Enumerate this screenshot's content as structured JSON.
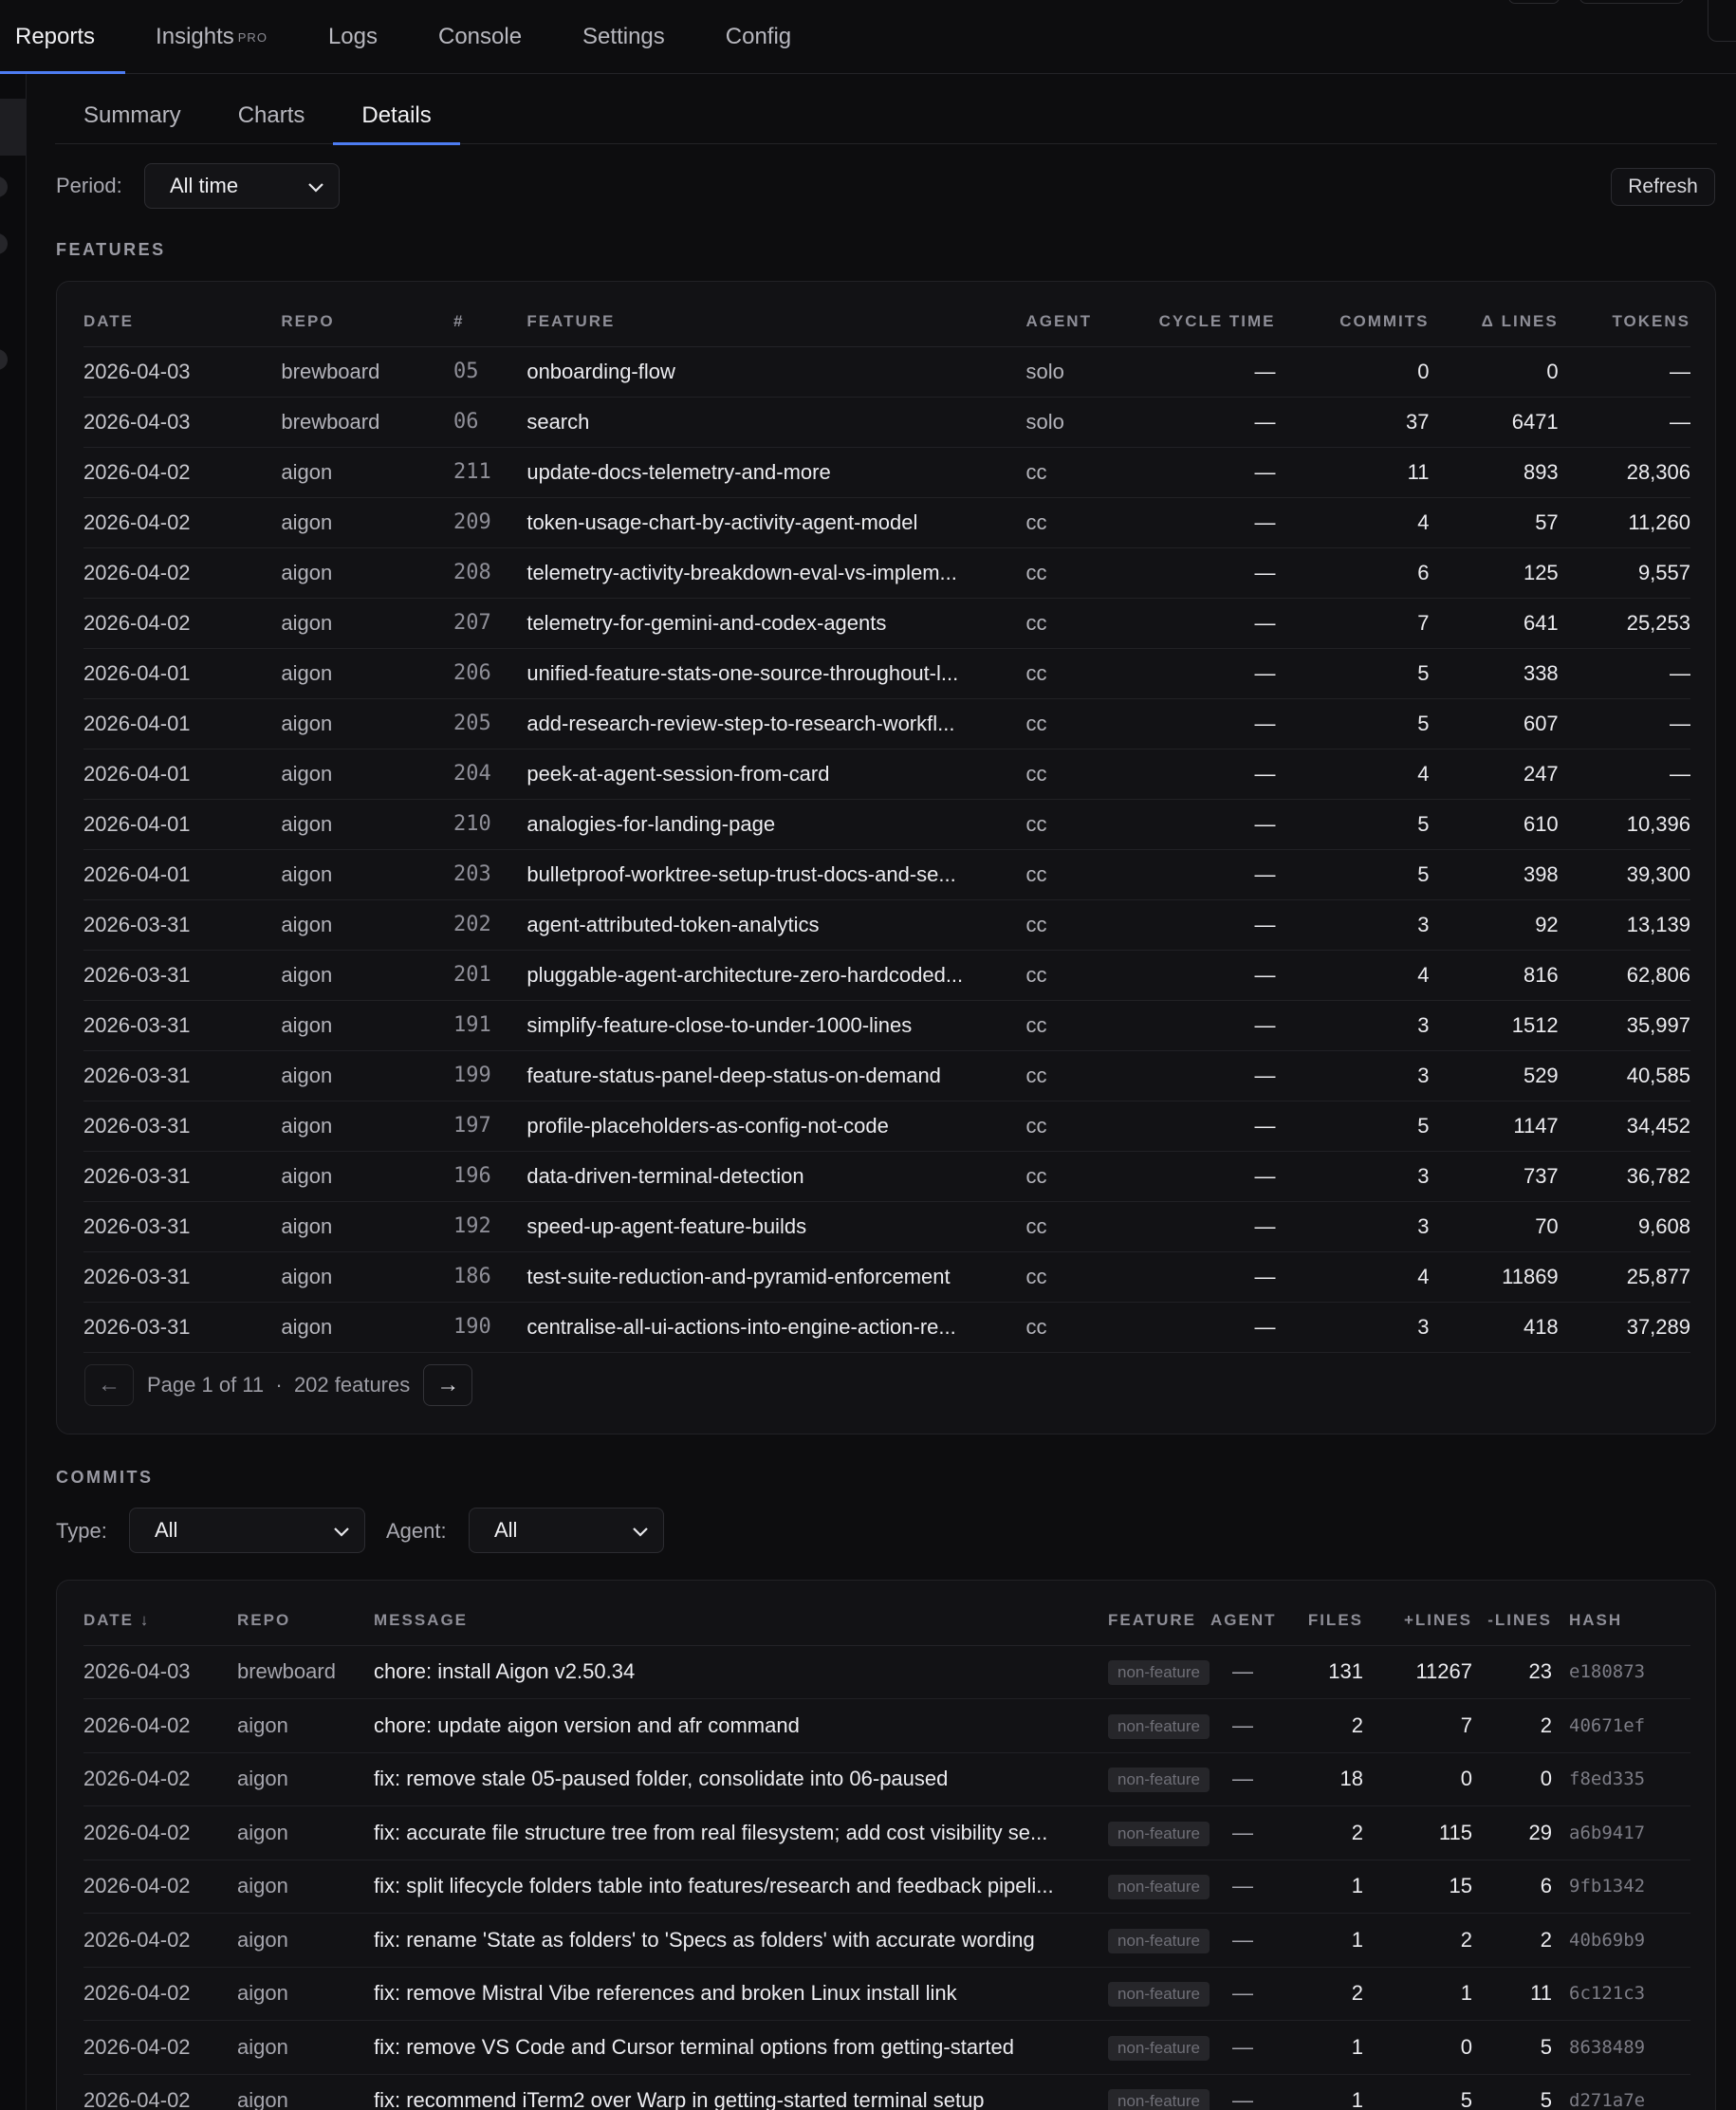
{
  "nav": {
    "tabs": [
      "Reports",
      "Insights",
      "Logs",
      "Console",
      "Settings",
      "Config"
    ],
    "pro_badge": "PRO"
  },
  "subtabs": [
    "Summary",
    "Charts",
    "Details"
  ],
  "period": {
    "label": "Period:",
    "value": "All time"
  },
  "refresh_label": "Refresh",
  "features": {
    "title": "FEATURES",
    "columns": [
      "DATE",
      "REPO",
      "#",
      "FEATURE",
      "AGENT",
      "CYCLE TIME",
      "COMMITS",
      "Δ LINES",
      "TOKENS"
    ],
    "rows": [
      [
        "2026-04-03",
        "brewboard",
        "05",
        "onboarding-flow",
        "solo",
        "—",
        "0",
        "0",
        "—"
      ],
      [
        "2026-04-03",
        "brewboard",
        "06",
        "search",
        "solo",
        "—",
        "37",
        "6471",
        "—"
      ],
      [
        "2026-04-02",
        "aigon",
        "211",
        "update-docs-telemetry-and-more",
        "cc",
        "—",
        "11",
        "893",
        "28,306"
      ],
      [
        "2026-04-02",
        "aigon",
        "209",
        "token-usage-chart-by-activity-agent-model",
        "cc",
        "—",
        "4",
        "57",
        "11,260"
      ],
      [
        "2026-04-02",
        "aigon",
        "208",
        "telemetry-activity-breakdown-eval-vs-implem...",
        "cc",
        "—",
        "6",
        "125",
        "9,557"
      ],
      [
        "2026-04-02",
        "aigon",
        "207",
        "telemetry-for-gemini-and-codex-agents",
        "cc",
        "—",
        "7",
        "641",
        "25,253"
      ],
      [
        "2026-04-01",
        "aigon",
        "206",
        "unified-feature-stats-one-source-throughout-l...",
        "cc",
        "—",
        "5",
        "338",
        "—"
      ],
      [
        "2026-04-01",
        "aigon",
        "205",
        "add-research-review-step-to-research-workfl...",
        "cc",
        "—",
        "5",
        "607",
        "—"
      ],
      [
        "2026-04-01",
        "aigon",
        "204",
        "peek-at-agent-session-from-card",
        "cc",
        "—",
        "4",
        "247",
        "—"
      ],
      [
        "2026-04-01",
        "aigon",
        "210",
        "analogies-for-landing-page",
        "cc",
        "—",
        "5",
        "610",
        "10,396"
      ],
      [
        "2026-04-01",
        "aigon",
        "203",
        "bulletproof-worktree-setup-trust-docs-and-se...",
        "cc",
        "—",
        "5",
        "398",
        "39,300"
      ],
      [
        "2026-03-31",
        "aigon",
        "202",
        "agent-attributed-token-analytics",
        "cc",
        "—",
        "3",
        "92",
        "13,139"
      ],
      [
        "2026-03-31",
        "aigon",
        "201",
        "pluggable-agent-architecture-zero-hardcoded...",
        "cc",
        "—",
        "4",
        "816",
        "62,806"
      ],
      [
        "2026-03-31",
        "aigon",
        "191",
        "simplify-feature-close-to-under-1000-lines",
        "cc",
        "—",
        "3",
        "1512",
        "35,997"
      ],
      [
        "2026-03-31",
        "aigon",
        "199",
        "feature-status-panel-deep-status-on-demand",
        "cc",
        "—",
        "3",
        "529",
        "40,585"
      ],
      [
        "2026-03-31",
        "aigon",
        "197",
        "profile-placeholders-as-config-not-code",
        "cc",
        "—",
        "5",
        "1147",
        "34,452"
      ],
      [
        "2026-03-31",
        "aigon",
        "196",
        "data-driven-terminal-detection",
        "cc",
        "—",
        "3",
        "737",
        "36,782"
      ],
      [
        "2026-03-31",
        "aigon",
        "192",
        "speed-up-agent-feature-builds",
        "cc",
        "—",
        "3",
        "70",
        "9,608"
      ],
      [
        "2026-03-31",
        "aigon",
        "186",
        "test-suite-reduction-and-pyramid-enforcement",
        "cc",
        "—",
        "4",
        "11869",
        "25,877"
      ],
      [
        "2026-03-31",
        "aigon",
        "190",
        "centralise-all-ui-actions-into-engine-action-re...",
        "cc",
        "—",
        "3",
        "418",
        "37,289"
      ]
    ],
    "pager": {
      "prev": "←",
      "next": "→",
      "page_text": "Page 1 of 11",
      "sep": "·",
      "count_text": "202 features"
    }
  },
  "commits": {
    "title": "COMMITS",
    "type_filter": {
      "label": "Type:",
      "value": "All"
    },
    "agent_filter": {
      "label": "Agent:",
      "value": "All"
    },
    "columns": [
      "DATE ↓",
      "REPO",
      "MESSAGE",
      "FEATURE",
      "AGENT",
      "FILES",
      "+LINES",
      "-LINES",
      "HASH"
    ],
    "rows": [
      [
        "2026-04-03",
        "brewboard",
        "chore: install Aigon v2.50.34",
        "non-feature",
        "—",
        "131",
        "11267",
        "23",
        "e180873"
      ],
      [
        "2026-04-02",
        "aigon",
        "chore: update aigon version and afr command",
        "non-feature",
        "—",
        "2",
        "7",
        "2",
        "40671ef"
      ],
      [
        "2026-04-02",
        "aigon",
        "fix: remove stale 05-paused folder, consolidate into 06-paused",
        "non-feature",
        "—",
        "18",
        "0",
        "0",
        "f8ed335"
      ],
      [
        "2026-04-02",
        "aigon",
        "fix: accurate file structure tree from real filesystem; add cost visibility se...",
        "non-feature",
        "—",
        "2",
        "115",
        "29",
        "a6b9417"
      ],
      [
        "2026-04-02",
        "aigon",
        "fix: split lifecycle folders table into features/research and feedback pipeli...",
        "non-feature",
        "—",
        "1",
        "15",
        "6",
        "9fb1342"
      ],
      [
        "2026-04-02",
        "aigon",
        "fix: rename 'State as folders' to 'Specs as folders' with accurate wording",
        "non-feature",
        "—",
        "1",
        "2",
        "2",
        "40b69b9"
      ],
      [
        "2026-04-02",
        "aigon",
        "fix: remove Mistral Vibe references and broken Linux install link",
        "non-feature",
        "—",
        "2",
        "1",
        "11",
        "6c121c3"
      ],
      [
        "2026-04-02",
        "aigon",
        "fix: remove VS Code and Cursor terminal options from getting-started",
        "non-feature",
        "—",
        "1",
        "0",
        "5",
        "8638489"
      ],
      [
        "2026-04-02",
        "aigon",
        "fix: recommend iTerm2 over Warp in getting-started terminal setup",
        "non-feature",
        "—",
        "1",
        "5",
        "5",
        "d271a7e"
      ]
    ]
  }
}
